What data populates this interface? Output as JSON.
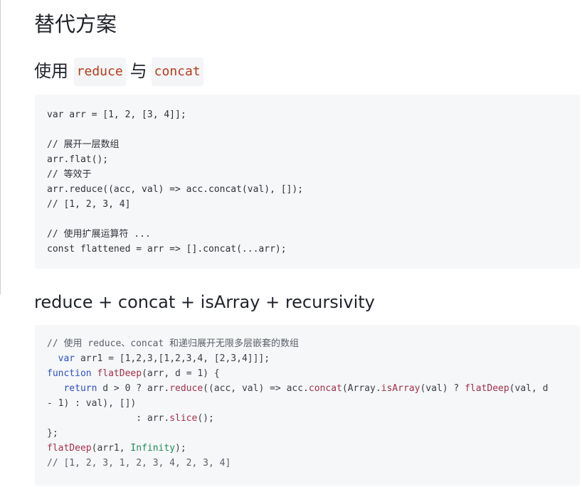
{
  "title": "替代方案",
  "section1": {
    "heading_prefix": "使用",
    "code_a": "reduce",
    "joiner": "与",
    "code_b": "concat",
    "code_lines": [
      "var arr = [1, 2, [3, 4]];",
      "",
      "// 展开一层数组",
      "arr.flat();",
      "// 等效于",
      "arr.reduce((acc, val) => acc.concat(val), []);",
      "// [1, 2, 3, 4]",
      "",
      "// 使用扩展运算符 ...",
      "const flattened = arr => [].concat(...arr);"
    ]
  },
  "section2": {
    "heading": "reduce + concat + isArray + recursivity",
    "code": {
      "l1": "// 使用 reduce、concat 和递归展开无限多层嵌套的数组",
      "l2_kw": "var",
      "l2_rest": " arr1 = [1,2,3,[1,2,3,4, [2,3,4]]];",
      "l3_kw": "function",
      "l3_fn": "flatDeep",
      "l3_rest": "(arr, d = 1) {",
      "l4_kw": "return",
      "l4_a": " d > 0 ? arr.",
      "l4_fn1": "reduce",
      "l4_b": "((acc, val) => acc.",
      "l4_fn2": "concat",
      "l4_c": "(Array.",
      "l4_fn3": "isArray",
      "l4_d": "(val) ? ",
      "l4_fn4": "flatDeep",
      "l4_e": "(val, d",
      "l5": "- 1) : val), [])",
      "l6_a": ": arr.",
      "l6_fn": "slice",
      "l6_b": "();",
      "l7": "};",
      "l8_fn": "flatDeep",
      "l8_a": "(arr1, ",
      "l8_builtin": "Infinity",
      "l8_b": ");",
      "l9": "// [1, 2, 3, 1, 2, 3, 4, 2, 3, 4]"
    }
  },
  "colors": {
    "keyword": "#2b4fc9",
    "function": "#a3304a",
    "builtin": "#1f8a5a",
    "inline_code": "#b93a1a",
    "code_bg": "#f6f7f9"
  }
}
